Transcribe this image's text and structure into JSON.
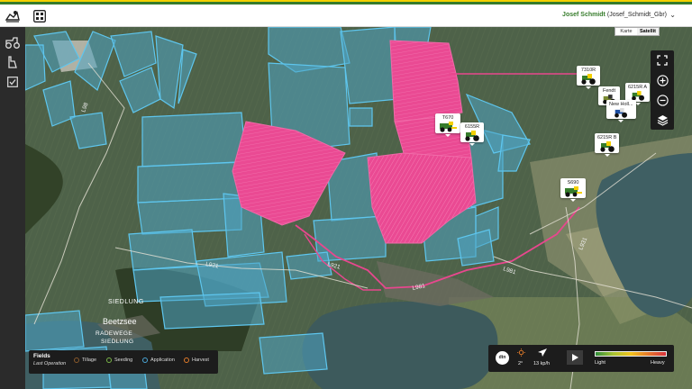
{
  "header": {
    "user_name": "Josef Schmidt",
    "user_org": "(Josef_Schmidt_Gbr)"
  },
  "icons": {
    "header": [
      "map-pin-icon",
      "grid-icon"
    ],
    "sidebar": [
      "tractor-icon",
      "field-boundary-icon",
      "checklist-icon"
    ]
  },
  "map": {
    "type_options": [
      "Karte",
      "Satellit"
    ],
    "selected_type": "Satellit",
    "road_labels": [
      "L98",
      "L921",
      "L921",
      "L981",
      "L981",
      "L931"
    ],
    "place_labels": [
      "SIEDLUNG",
      "Beetzsee",
      "RADEWEGE",
      "SIEDLUNG"
    ],
    "vehicles": [
      {
        "label": "7310R",
        "kind": "tractor"
      },
      {
        "label": "Fendt",
        "kind": "tractor"
      },
      {
        "label": "6215R A",
        "kind": "tractor"
      },
      {
        "label": "New Holl...",
        "kind": "tractor"
      },
      {
        "label": "T670",
        "kind": "combine"
      },
      {
        "label": "6155R",
        "kind": "tractor"
      },
      {
        "label": "6215R B",
        "kind": "tractor"
      },
      {
        "label": "S690",
        "kind": "combine"
      }
    ],
    "controls": [
      "fullscreen-icon",
      "zoom-in-icon",
      "zoom-out-icon",
      "layers-icon"
    ]
  },
  "legend": {
    "title": "Fields",
    "subtitle": "Last Operation",
    "items": [
      {
        "label": "Tillage",
        "color": "#8a5a2b"
      },
      {
        "label": "Seeding",
        "color": "#7ab648"
      },
      {
        "label": "Application",
        "color": "#4aa8d8"
      },
      {
        "label": "Harvest",
        "color": "#e27b2a"
      }
    ]
  },
  "infobar": {
    "logo_text": "dtn",
    "temp": "2°",
    "wind": "13 kp/h",
    "heat_low": "Light",
    "heat_high": "Heavy"
  },
  "colors": {
    "jd_green": "#367c2b",
    "jd_yellow": "#f4d000",
    "field_applied": "#e8478e",
    "field_outline": "#5ec6ee"
  }
}
